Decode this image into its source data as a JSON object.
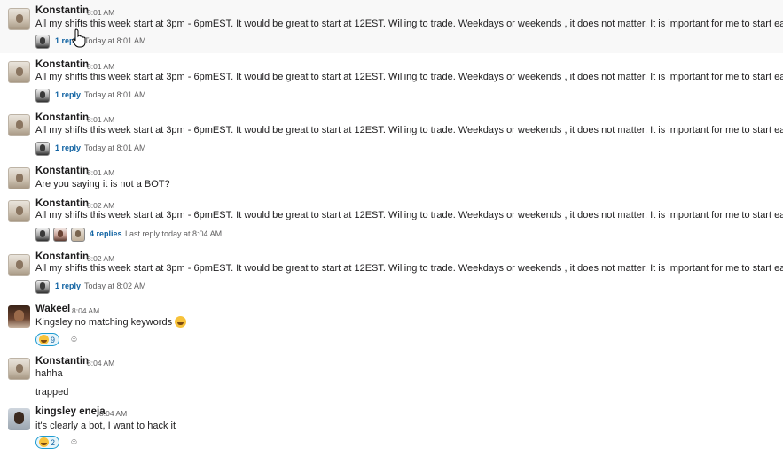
{
  "toolbar": {
    "icons": [
      "emoji-reaction-icon",
      "reply-thread-icon",
      "share-forward-icon",
      "bookmark-icon"
    ]
  },
  "messages": [
    {
      "author": "Konstantin",
      "time": "8:01 AM",
      "text": "All my shifts this week start at 3pm - 6pmEST. It would be great to start at 12EST. Willing to trade. Weekdays or weekends , it does not matter. It is important for me to start earlier",
      "reply_count": "1 reply",
      "reply_time": "Today at 8:01 AM"
    },
    {
      "author": "Konstantin",
      "time": "8:01 AM",
      "text": "All my shifts this week start at 3pm - 6pmEST. It would be great to start at 12EST. Willing to trade. Weekdays or weekends , it does not matter. It is important for me to start earlier",
      "reply_count": "1 reply",
      "reply_time": "Today at 8:01 AM"
    },
    {
      "author": "Konstantin",
      "time": "8:01 AM",
      "text": "All my shifts this week start at 3pm - 6pmEST. It would be great to start at 12EST. Willing to trade. Weekdays or weekends , it does not matter. It is important for me to start earlier",
      "reply_count": "1 reply",
      "reply_time": "Today at 8:01 AM"
    },
    {
      "author": "Konstantin",
      "time": "8:01 AM",
      "text": "Are you saying it is not a BOT?"
    },
    {
      "author": "Konstantin",
      "time": "8:02 AM",
      "text": "All my shifts this week start at 3pm - 6pmEST. It would be great to start at 12EST. Willing to trade. Weekdays or weekends , it does not matter. It is important for me to start earlier",
      "reply_count": "4 replies",
      "reply_time": "Last reply today at 8:04 AM"
    },
    {
      "author": "Konstantin",
      "time": "8:02 AM",
      "text": "All my shifts this week start at 3pm - 6pmEST. It would be great to start at 12EST. Willing to trade. Weekdays or weekends , it does not matter. It is important for me to start earlier",
      "reply_count": "1 reply",
      "reply_time": "Today at 8:02 AM"
    },
    {
      "author": "Wakeel",
      "time": "8:04 AM",
      "text": "Kingsley no matching keywords",
      "reaction_count": "9"
    },
    {
      "author": "Konstantin",
      "time": "8:04 AM",
      "text": "hahha",
      "text2": "trapped"
    },
    {
      "author": "kingsley eneja",
      "time": "8:04 AM",
      "text": "it's clearly a bot, I want to hack it",
      "reaction_count": "2"
    }
  ]
}
